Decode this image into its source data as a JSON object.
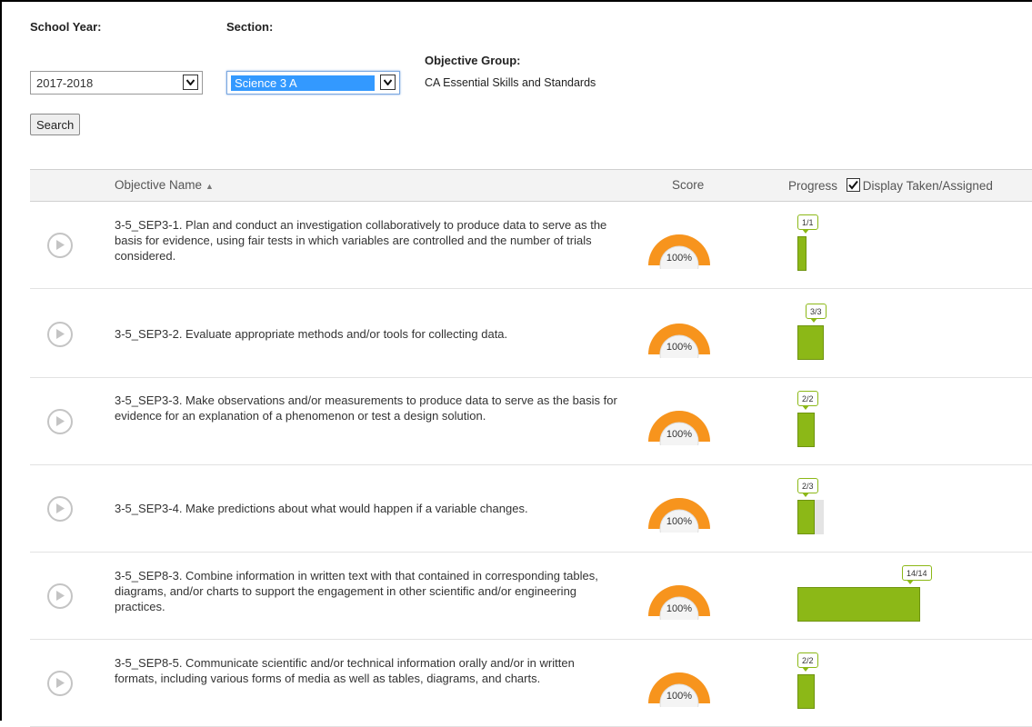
{
  "filters": {
    "school_year_label": "School Year:",
    "school_year_value": "2017-2018",
    "section_label": "Section:",
    "section_value": "Science 3 A",
    "objective_group_label": "Objective Group:",
    "objective_group_value": "CA Essential Skills and Standards",
    "search_label": "Search"
  },
  "table": {
    "col_objective": "Objective Name",
    "col_score": "Score",
    "col_progress": "Progress",
    "display_taken_label": "Display Taken/Assigned",
    "display_taken_checked": true
  },
  "colors": {
    "gauge": "#f7941d",
    "progress": "#8cb817",
    "selection": "#3399ff"
  },
  "rows": [
    {
      "text": "3-5_SEP3-1. Plan and conduct an investigation collaboratively to produce data to serve as the basis for evidence, using fair tests in which variables are controlled and the number of trials considered.",
      "score": "100%",
      "score_value": 1.0,
      "taken": 1,
      "assigned": 1,
      "progress_label": "1/1"
    },
    {
      "text": "3-5_SEP3-2. Evaluate appropriate methods and/or tools for collecting data.",
      "score": "100%",
      "score_value": 1.0,
      "taken": 3,
      "assigned": 3,
      "progress_label": "3/3"
    },
    {
      "text": "3-5_SEP3-3. Make observations and/or measurements to produce data to serve as the basis for evidence for an explanation of a phenomenon or test a design solution.",
      "score": "100%",
      "score_value": 1.0,
      "taken": 2,
      "assigned": 2,
      "progress_label": "2/2"
    },
    {
      "text": "3-5_SEP3-4. Make predictions about what would happen if a variable changes.",
      "score": "100%",
      "score_value": 1.0,
      "taken": 2,
      "assigned": 3,
      "progress_label": "2/3"
    },
    {
      "text": "3-5_SEP8-3. Combine information in written text with that contained in corresponding tables, diagrams, and/or charts to support the engagement in other scientific and/or engineering practices.",
      "score": "100%",
      "score_value": 1.0,
      "taken": 14,
      "assigned": 14,
      "progress_label": "14/14"
    },
    {
      "text": "3-5_SEP8-5. Communicate scientific and/or technical information orally and/or in written formats, including various forms of media as well as tables, diagrams, and charts.",
      "score": "100%",
      "score_value": 1.0,
      "taken": 2,
      "assigned": 2,
      "progress_label": "2/2"
    }
  ]
}
